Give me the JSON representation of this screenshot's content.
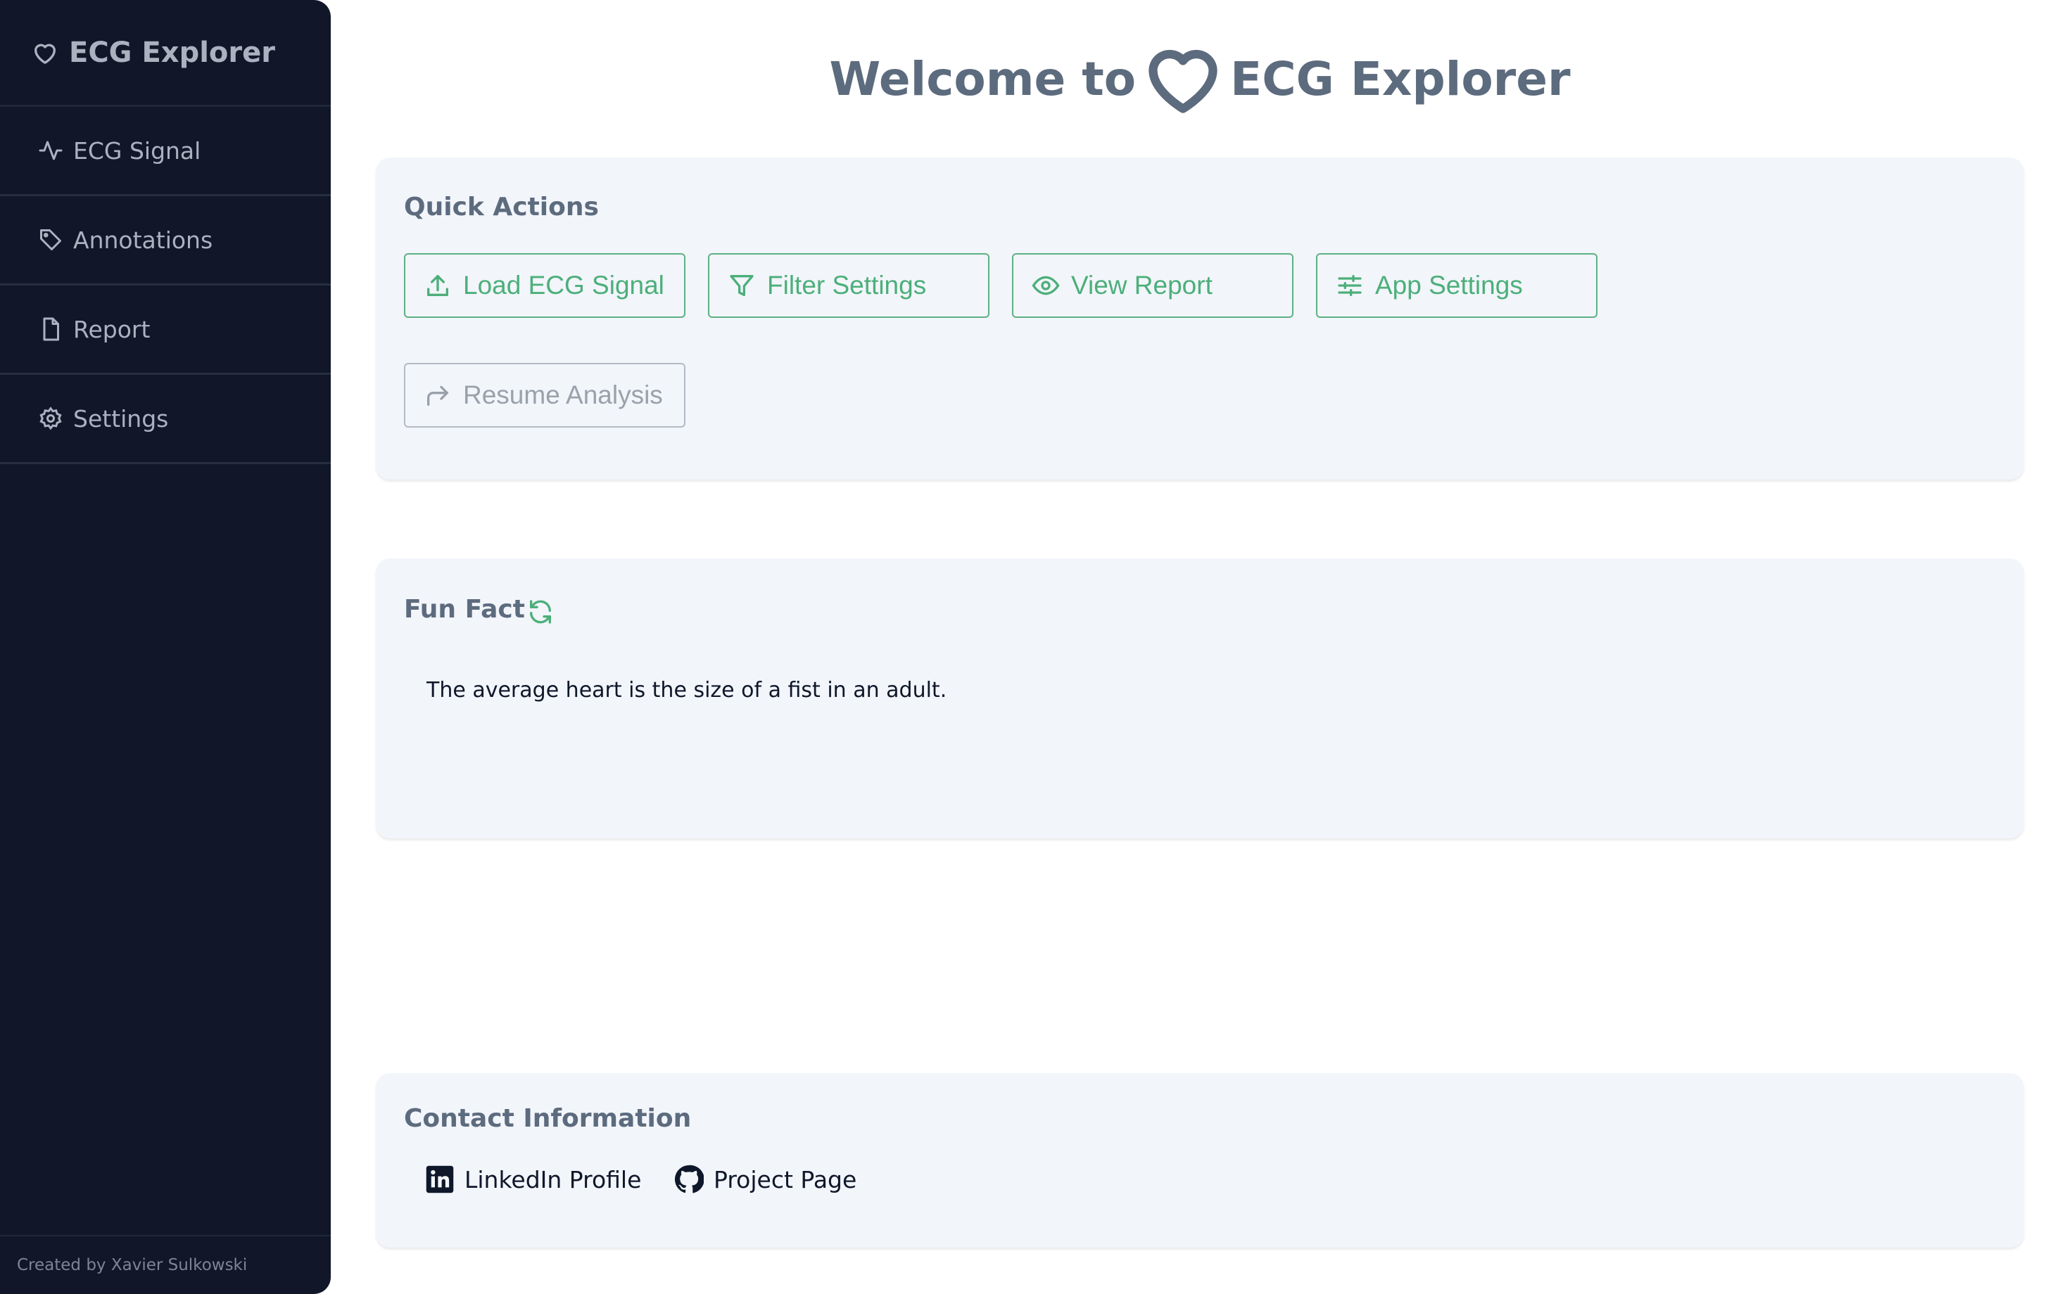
{
  "sidebar": {
    "title": "ECG Explorer",
    "items": [
      {
        "label": "ECG Signal",
        "icon": "activity-icon"
      },
      {
        "label": "Annotations",
        "icon": "tag-icon"
      },
      {
        "label": "Report",
        "icon": "file-icon"
      },
      {
        "label": "Settings",
        "icon": "gear-icon"
      }
    ],
    "footer": "Created by Xavier Sulkowski"
  },
  "header": {
    "title_prefix": "Welcome to",
    "title_suffix": "ECG Explorer"
  },
  "quick_actions": {
    "title": "Quick Actions",
    "buttons": [
      {
        "label": "Load ECG Signal",
        "icon": "upload-icon"
      },
      {
        "label": "Filter Settings",
        "icon": "filter-icon"
      },
      {
        "label": "View Report",
        "icon": "eye-icon"
      },
      {
        "label": "App Settings",
        "icon": "sliders-icon"
      },
      {
        "label": "Resume Analysis",
        "icon": "forward-arrow-icon",
        "disabled": true
      }
    ]
  },
  "fun_fact": {
    "title": "Fun Fact",
    "text": "The average heart is the size of a fist in an adult."
  },
  "contact": {
    "title": "Contact Information",
    "links": [
      {
        "label": "LinkedIn Profile",
        "icon": "linkedin-icon"
      },
      {
        "label": "Project Page",
        "icon": "github-icon"
      }
    ]
  },
  "colors": {
    "sidebar_bg": "#111729",
    "accent": "#4caf7a",
    "card_bg": "#f2f5fa",
    "heading": "#5d6b7e"
  }
}
